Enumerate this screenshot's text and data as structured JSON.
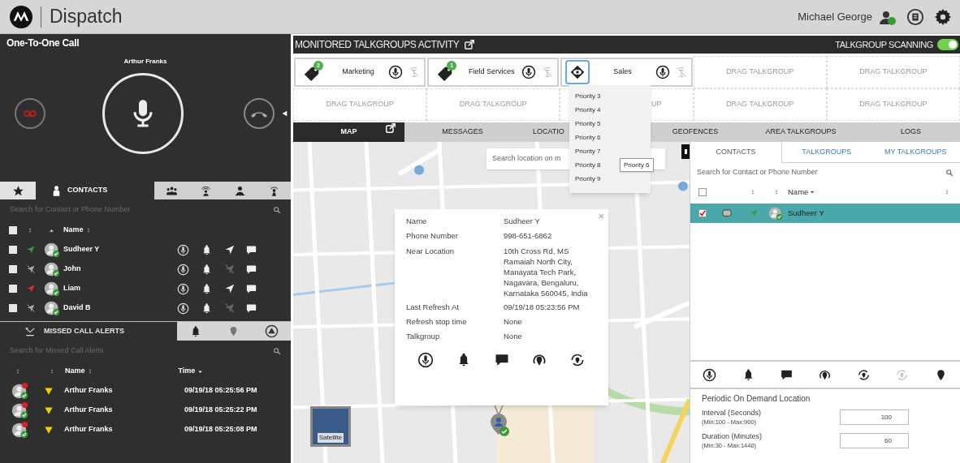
{
  "header": {
    "app_title": "Dispatch",
    "user_name": "Michael George"
  },
  "call": {
    "title": "One-To-One Call",
    "caller": "Arthur Franks"
  },
  "contact_tabs": [
    {
      "kind": "favorites",
      "selected": false
    },
    {
      "kind": "contacts",
      "label": "CONTACTS",
      "selected": true
    },
    {
      "kind": "groups",
      "selected": false
    },
    {
      "kind": "broadcast",
      "selected": false
    },
    {
      "kind": "team",
      "selected": false
    },
    {
      "kind": "dispatcher",
      "selected": false
    }
  ],
  "contacts": {
    "search_placeholder": "Search for Contact or Phone Number",
    "all_checked": false,
    "name_header": "Name",
    "rows": [
      {
        "name": "Sudheer Y",
        "checked": false,
        "located": true,
        "color": "#3c9a3c"
      },
      {
        "name": "John",
        "checked": false,
        "located": false
      },
      {
        "name": "Liam",
        "checked": false,
        "located": true,
        "color": "#d93030"
      },
      {
        "name": "David B",
        "checked": false,
        "located": false
      }
    ]
  },
  "missed_alerts": {
    "tab_label": "MISSED CALL ALERTS",
    "search_placeholder": "Search for Missed Call Alerts",
    "name_header": "Name",
    "time_header": "Time",
    "rows": [
      {
        "name": "Arthur Franks",
        "time": "09/19/18 05:25:56 PM"
      },
      {
        "name": "Arthur Franks",
        "time": "09/19/18 05:25:22 PM"
      },
      {
        "name": "Arthur Franks",
        "time": "09/19/18 05:25:08 PM"
      }
    ]
  },
  "monitor": {
    "title": "MONITORED TALKGROUPS ACTIVITY",
    "scanning_label": "TALKGROUP SCANNING",
    "scanning_on": true
  },
  "talkgroup_cells": [
    {
      "kind": "tag",
      "name": "Marketing",
      "badge": "2",
      "selected": false
    },
    {
      "kind": "tag",
      "name": "Field Services",
      "badge": "1",
      "selected": false
    },
    {
      "kind": "watch",
      "name": "Sales",
      "selected": true
    },
    {
      "kind": "slot",
      "text": "DRAG TALKGROUP"
    },
    {
      "kind": "slot",
      "text": "DRAG TALKGROUP"
    },
    {
      "kind": "slot",
      "text": "DRAG TALKGROUP"
    },
    {
      "kind": "slot",
      "text": "DRAG TALKGROUP"
    },
    {
      "kind": "slot",
      "text": "UP"
    },
    {
      "kind": "slot",
      "text": "DRAG TALKGROUP"
    },
    {
      "kind": "slot",
      "text": "DRAG TALKGROUP"
    }
  ],
  "tabs": [
    {
      "label": "MAP",
      "selected": true
    },
    {
      "label": "MESSAGES",
      "selected": false
    },
    {
      "label": "LOCATIO",
      "selected": false
    },
    {
      "label": "GEOFENCES",
      "selected": false
    },
    {
      "label": "AREA TALKGROUPS",
      "selected": false
    },
    {
      "label": "LOGS",
      "selected": false
    }
  ],
  "priority_menu": {
    "items": [
      "Priority 3",
      "Priority 4",
      "Priority 5",
      "Priority 6",
      "Priority 7",
      "Priority 8",
      "Priority 9"
    ],
    "tooltip": "Priority 6"
  },
  "map": {
    "kind": "picture",
    "search_placeholder": "Search location on m",
    "satellite_label": "Satellite"
  },
  "popup": {
    "fields": [
      {
        "label": "Name",
        "value": "Sudheer Y"
      },
      {
        "label": "Phone Number",
        "value": "998-651-6862"
      },
      {
        "label": "Near Location",
        "value": "10th Cross Rd, MS Ramaiah North City, Manayata Tech Park, Nagavara, Bengaluru, Karnataka 560045, India"
      },
      {
        "label": "Last Refresh At",
        "value": "09/19/18 05:23:56 PM"
      },
      {
        "label": "Refresh stop time",
        "value": "None"
      },
      {
        "label": "Talkgroup",
        "value": "None"
      }
    ]
  },
  "side_panel": {
    "tabs": [
      {
        "label": "CONTACTS",
        "selected": true
      },
      {
        "label": "TALKGROUPS",
        "selected": false
      },
      {
        "label": "MY TALKGROUPS",
        "selected": false
      }
    ],
    "search_placeholder": "Search for Contact or Phone Number",
    "all_checked": false,
    "name_header": "Name",
    "rows": [
      {
        "name": "Sudheer Y",
        "selected": true,
        "checked": true,
        "located": true,
        "color": "#3c9a3c"
      }
    ]
  },
  "action_bar": [
    {
      "kind": "ptt",
      "disabled": false
    },
    {
      "kind": "alert",
      "disabled": false
    },
    {
      "kind": "message",
      "disabled": false
    },
    {
      "kind": "locate",
      "disabled": false
    },
    {
      "kind": "track",
      "disabled": false
    },
    {
      "kind": "track",
      "disabled": true
    },
    {
      "kind": "pin",
      "disabled": false
    }
  ],
  "periodic": {
    "title": "Periodic On Demand Location",
    "fields": [
      {
        "label": "Interval (Seconds)",
        "hint": "(Min:100 - Max:900)",
        "value": "100"
      },
      {
        "label": "Duration (Minutes)",
        "hint": "(Min:30 - Max:1440)",
        "value": "60"
      }
    ]
  }
}
